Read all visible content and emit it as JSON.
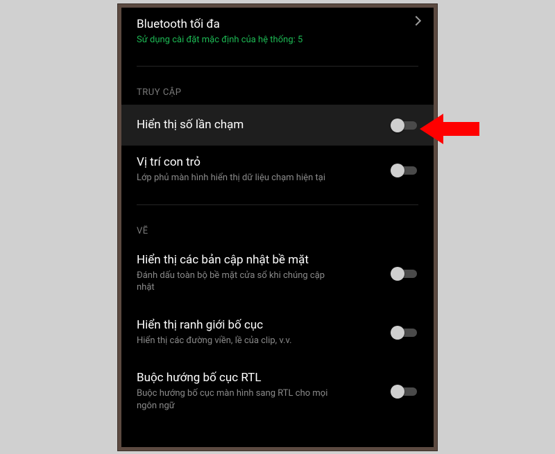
{
  "top_item": {
    "title": "Bluetooth tối đa",
    "subtitle": "Sử dụng cài đặt mặc định của hệ thống: 5"
  },
  "sections": {
    "access": {
      "header": "TRUY CẬP",
      "items": {
        "show_taps": {
          "title": "Hiển thị số lần chạm"
        },
        "pointer_loc": {
          "title": "Vị trí con trỏ",
          "subtitle": "Lớp phủ màn hình hiển thị dữ liệu chạm hiện tại"
        }
      }
    },
    "draw": {
      "header": "VẼ",
      "items": {
        "surface_updates": {
          "title": "Hiển thị các bản cập nhật bề mặt",
          "subtitle": "Đánh dấu toàn bộ bề mặt cửa sổ khi chúng cập nhật"
        },
        "layout_bounds": {
          "title": "Hiển thị ranh giới bố cục",
          "subtitle": "Hiển thị các đường viền, lề của clip, v.v."
        },
        "force_rtl": {
          "title": "Buộc hướng bố cục RTL",
          "subtitle": "Buộc hướng bố cục màn hình sang RTL cho mọi ngôn ngữ"
        }
      }
    }
  },
  "annotation": {
    "arrow_color": "#ff0000"
  }
}
